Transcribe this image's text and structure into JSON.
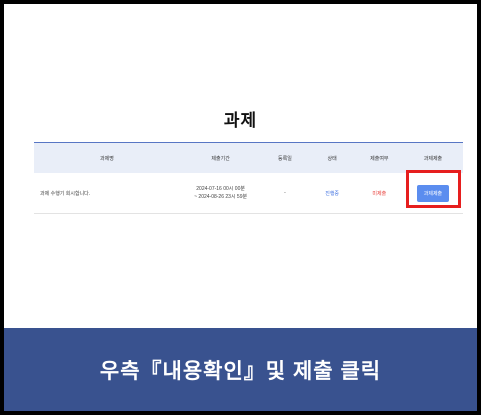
{
  "page": {
    "title": "과제"
  },
  "table": {
    "headers": [
      "과제명",
      "제출기간",
      "등록일",
      "상태",
      "제출여부",
      "과제제출"
    ],
    "rows": [
      {
        "name": "과제 수행기 회시합니다.",
        "period_start": "2024-07-16 00시 00분",
        "period_end": "~ 2024-08-26 23시 59분",
        "registered": "-",
        "status": "진행중",
        "submitted": "미제출",
        "action": "과제제출"
      }
    ]
  },
  "caption": {
    "text": "우측『내용확인』및 제출 클릭"
  },
  "colors": {
    "header_bg": "#e9eef8",
    "header_line": "#5876c4",
    "status_progress": "#3d6fe0",
    "status_unsubmitted": "#e8413c",
    "button_bg": "#5b8def",
    "highlight": "#e61e1e",
    "caption_bg": "#39528f"
  }
}
